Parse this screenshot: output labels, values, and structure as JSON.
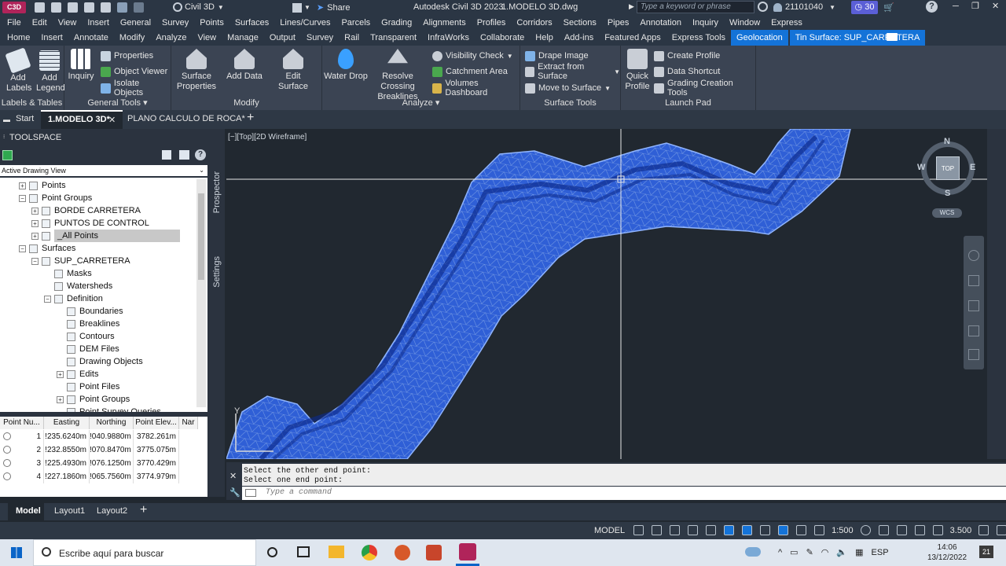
{
  "titlebar": {
    "app_badge": "C3D",
    "workspace": "Civil 3D",
    "share": "Share",
    "app_title": "Autodesk Civil 3D 2023",
    "file_title": "1.MODELO 3D.dwg",
    "search_placeholder": "Type a keyword or phrase",
    "user": "21101040",
    "trial_days": "30"
  },
  "menubar": [
    "File",
    "Edit",
    "View",
    "Insert",
    "General",
    "Survey",
    "Points",
    "Surfaces",
    "Lines/Curves",
    "Parcels",
    "Grading",
    "Alignments",
    "Profiles",
    "Corridors",
    "Sections",
    "Pipes",
    "Annotation",
    "Inquiry",
    "Window",
    "Express"
  ],
  "ribbon_tabs": [
    {
      "label": "Home",
      "active": false
    },
    {
      "label": "Insert",
      "active": false
    },
    {
      "label": "Annotate",
      "active": false
    },
    {
      "label": "Modify",
      "active": false
    },
    {
      "label": "Analyze",
      "active": false
    },
    {
      "label": "View",
      "active": false
    },
    {
      "label": "Manage",
      "active": false
    },
    {
      "label": "Output",
      "active": false
    },
    {
      "label": "Survey",
      "active": false
    },
    {
      "label": "Rail",
      "active": false
    },
    {
      "label": "Transparent",
      "active": false
    },
    {
      "label": "InfraWorks",
      "active": false
    },
    {
      "label": "Collaborate",
      "active": false
    },
    {
      "label": "Help",
      "active": false
    },
    {
      "label": "Add-ins",
      "active": false
    },
    {
      "label": "Featured Apps",
      "active": false
    },
    {
      "label": "Express Tools",
      "active": false
    },
    {
      "label": "Geolocation",
      "active": true
    },
    {
      "label": "Tin Surface: SUP_CARRETERA",
      "active": true
    }
  ],
  "ribbon": {
    "labels_tables": {
      "title": "Labels & Tables",
      "add_labels": "Add Labels",
      "add_legend": "Add Legend"
    },
    "general_tools": {
      "title": "General Tools",
      "inquiry": "Inquiry",
      "properties": "Properties",
      "object_viewer": "Object Viewer",
      "isolate_objects": "Isolate Objects"
    },
    "modify": {
      "title": "Modify",
      "surface_properties": "Surface Properties",
      "add_data": "Add Data",
      "edit_surface": "Edit Surface"
    },
    "analyze": {
      "title": "Analyze",
      "water_drop": "Water Drop",
      "resolve_crossing": "Resolve Crossing Breaklines",
      "visibility_check": "Visibility Check",
      "catchment_area": "Catchment Area",
      "volumes_dashboard": "Volumes Dashboard"
    },
    "surface_tools": {
      "title": "Surface Tools",
      "drape_image": "Drape Image",
      "extract_from_surface": "Extract from Surface",
      "move_to_surface": "Move to Surface"
    },
    "launch_pad": {
      "title": "Launch Pad",
      "quick_profile": "Quick Profile",
      "create_profile": "Create Profile",
      "data_shortcut": "Data Shortcut",
      "grading_creation_tools": "Grading Creation Tools"
    }
  },
  "doc_tabs": [
    "Start",
    "1.MODELO 3D*",
    "PLANO CALCULO DE ROCA*"
  ],
  "toolspace": {
    "title": "TOOLSPACE",
    "view_select": "Active Drawing View",
    "side_tabs": [
      "Prospector",
      "Settings"
    ],
    "tree": [
      {
        "label": "Points",
        "indent": 1,
        "pm": "+"
      },
      {
        "label": "Point Groups",
        "indent": 1,
        "pm": "-"
      },
      {
        "label": "BORDE CARRETERA",
        "indent": 2,
        "pm": "+"
      },
      {
        "label": "PUNTOS DE CONTROL",
        "indent": 2,
        "pm": "+"
      },
      {
        "label": "_All Points",
        "indent": 2,
        "pm": "+",
        "selected": true
      },
      {
        "label": "Surfaces",
        "indent": 1,
        "pm": "-"
      },
      {
        "label": "SUP_CARRETERA",
        "indent": 2,
        "pm": "-"
      },
      {
        "label": "Masks",
        "indent": 3,
        "pm": ""
      },
      {
        "label": "Watersheds",
        "indent": 3,
        "pm": ""
      },
      {
        "label": "Definition",
        "indent": 3,
        "pm": "-"
      },
      {
        "label": "Boundaries",
        "indent": 4,
        "pm": ""
      },
      {
        "label": "Breaklines",
        "indent": 4,
        "pm": ""
      },
      {
        "label": "Contours",
        "indent": 4,
        "pm": ""
      },
      {
        "label": "DEM Files",
        "indent": 4,
        "pm": ""
      },
      {
        "label": "Drawing Objects",
        "indent": 4,
        "pm": ""
      },
      {
        "label": "Edits",
        "indent": 4,
        "pm": "+"
      },
      {
        "label": "Point Files",
        "indent": 4,
        "pm": ""
      },
      {
        "label": "Point Groups",
        "indent": 4,
        "pm": "+"
      },
      {
        "label": "Point Survey Queries",
        "indent": 4,
        "pm": ""
      }
    ],
    "table_headers": [
      "Point Nu...",
      "Easting",
      "Northing",
      "Point Elev...",
      "Nar"
    ],
    "table_rows": [
      [
        "1",
        "!235.6240m",
        "!040.9880m",
        "3782.261m"
      ],
      [
        "2",
        "!232.8550m",
        "!070.8470m",
        "3775.075m"
      ],
      [
        "3",
        "!225.4930m",
        "!076.1250m",
        "3770.429m"
      ],
      [
        "4",
        "!227.1860m",
        "!065.7560m",
        "3774.979m"
      ]
    ]
  },
  "viewport": {
    "label": "[−][Top][2D Wireframe]",
    "compass": {
      "n": "N",
      "s": "S",
      "e": "E",
      "w": "W",
      "top": "TOP",
      "wcs": "WCS"
    },
    "ucs_y": "Y"
  },
  "command": {
    "line1": "Select the other end point:",
    "line2": "Select one end point:",
    "placeholder": "Type a command"
  },
  "layouts": [
    "Model",
    "Layout1",
    "Layout2"
  ],
  "status": {
    "model": "MODEL",
    "scale": "1:500",
    "lineweight": "3.500"
  },
  "taskbar": {
    "search_placeholder": "Escribe aquí para buscar",
    "lang": "ESP",
    "time": "14:06",
    "date": "13/12/2022",
    "notif": "21"
  },
  "colors": {
    "accent": "#1473d8",
    "surface_fill": "#2f5fd6",
    "surface_line": "#8fb4ff"
  }
}
